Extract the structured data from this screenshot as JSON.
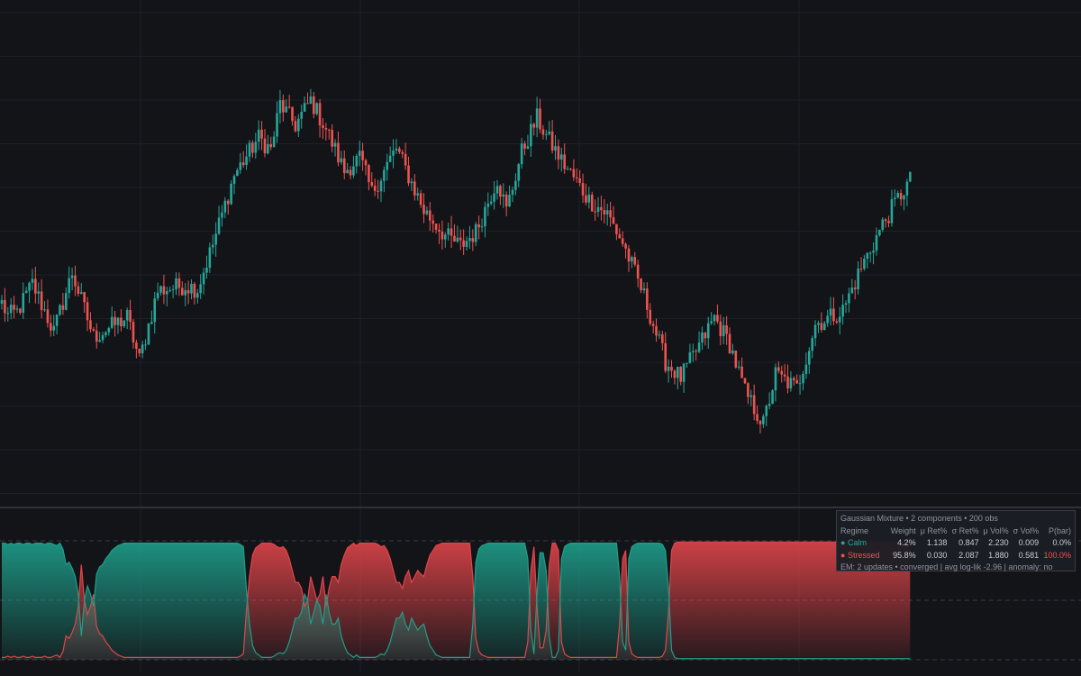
{
  "chart_data": [
    {
      "type": "candlestick",
      "colors": {
        "up": "#26a69a",
        "down": "#ef5350"
      },
      "grid": true,
      "segments": [
        [
          0,
          0.6
        ],
        [
          2,
          0.25
        ],
        [
          5,
          0.35
        ],
        [
          10,
          1.15
        ],
        [
          17,
          -0.2
        ],
        [
          23,
          1.45
        ],
        [
          30,
          -0.35
        ],
        [
          41,
          0.2
        ],
        [
          45,
          -1.0
        ],
        [
          51,
          0.95
        ],
        [
          60,
          1.1
        ],
        [
          64,
          1.0
        ],
        [
          69,
          2.25
        ],
        [
          76,
          4.2
        ],
        [
          84,
          5.25
        ],
        [
          88,
          4.9
        ],
        [
          91,
          6.2
        ],
        [
          96,
          5.6
        ],
        [
          101,
          6.3
        ],
        [
          106,
          5.5
        ],
        [
          112,
          4.3
        ],
        [
          117,
          4.7
        ],
        [
          121,
          3.7
        ],
        [
          129,
          4.95
        ],
        [
          138,
          3.2
        ],
        [
          145,
          2.5
        ],
        [
          150,
          2.2
        ],
        [
          155,
          2.6
        ],
        [
          162,
          4.1
        ],
        [
          165,
          3.2
        ],
        [
          170,
          4.85
        ],
        [
          175,
          5.8
        ],
        [
          178,
          5.3
        ],
        [
          183,
          4.6
        ],
        [
          188,
          4.0
        ],
        [
          192,
          3.5
        ],
        [
          198,
          3.1
        ],
        [
          203,
          2.3
        ],
        [
          210,
          0.8
        ],
        [
          217,
          -1.05
        ],
        [
          222,
          -1.5
        ],
        [
          228,
          -0.6
        ],
        [
          233,
          0.2
        ],
        [
          238,
          -0.55
        ],
        [
          243,
          -1.9
        ],
        [
          249,
          -2.8
        ],
        [
          253,
          -1.4
        ],
        [
          260,
          -1.8
        ],
        [
          266,
          0.0
        ],
        [
          275,
          0.4
        ],
        [
          281,
          1.6
        ],
        [
          288,
          2.8
        ],
        [
          292,
          3.4
        ],
        [
          297,
          4.05
        ]
      ],
      "bar_count": 298
    },
    {
      "type": "area",
      "ylim": [
        0,
        1
      ],
      "series": [
        {
          "color": "#1e9e8a",
          "values": [
            0.98,
            0.98,
            0.97,
            0.98,
            0.97,
            0.98,
            0.98,
            0.97,
            0.98,
            0.98,
            0.97,
            0.98,
            0.98,
            0.98,
            0.97,
            0.98,
            0.98,
            0.97,
            0.96,
            0.98,
            0.93,
            0.8,
            0.82,
            0.77,
            0.7,
            0.55,
            0.2,
            0.5,
            0.62,
            0.55,
            0.45,
            0.72,
            0.78,
            0.8,
            0.85,
            0.88,
            0.92,
            0.94,
            0.96,
            0.97,
            0.98,
            0.98,
            0.98,
            0.98,
            0.98,
            0.98,
            0.98,
            0.98,
            0.98,
            0.98,
            0.98,
            0.98,
            0.98,
            0.98,
            0.98,
            0.98,
            0.98,
            0.98,
            0.98,
            0.98,
            0.98,
            0.98,
            0.98,
            0.98,
            0.98,
            0.98,
            0.98,
            0.98,
            0.98,
            0.98,
            0.98,
            0.98,
            0.98,
            0.98,
            0.98,
            0.98,
            0.98,
            0.98,
            0.97,
            0.95,
            0.58,
            0.3,
            0.12,
            0.06,
            0.04,
            0.02,
            0.02,
            0.02,
            0.02,
            0.03,
            0.05,
            0.06,
            0.05,
            0.08,
            0.15,
            0.25,
            0.35,
            0.35,
            0.4,
            0.55,
            0.5,
            0.3,
            0.4,
            0.5,
            0.45,
            0.3,
            0.55,
            0.4,
            0.3,
            0.3,
            0.35,
            0.2,
            0.12,
            0.06,
            0.04,
            0.02,
            0.04,
            0.02,
            0.02,
            0.02,
            0.02,
            0.02,
            0.02,
            0.03,
            0.05,
            0.04,
            0.08,
            0.15,
            0.25,
            0.35,
            0.35,
            0.4,
            0.3,
            0.25,
            0.35,
            0.3,
            0.25,
            0.28,
            0.3,
            0.2,
            0.12,
            0.08,
            0.04,
            0.03,
            0.02,
            0.02,
            0.02,
            0.02,
            0.02,
            0.02,
            0.02,
            0.02,
            0.02,
            0.02,
            0.3,
            0.82,
            0.93,
            0.96,
            0.97,
            0.98,
            0.98,
            0.98,
            0.98,
            0.98,
            0.98,
            0.98,
            0.98,
            0.98,
            0.98,
            0.98,
            0.98,
            0.98,
            0.85,
            0.25,
            0.05,
            0.55,
            0.9,
            0.9,
            0.75,
            0.2,
            0.02,
            0.02,
            0.08,
            0.85,
            0.95,
            0.97,
            0.98,
            0.98,
            0.98,
            0.98,
            0.98,
            0.98,
            0.98,
            0.98,
            0.98,
            0.98,
            0.98,
            0.98,
            0.98,
            0.98,
            0.98,
            0.98,
            0.7,
            0.15,
            0.08,
            0.85,
            0.95,
            0.97,
            0.98,
            0.98,
            0.98,
            0.98,
            0.98,
            0.98,
            0.98,
            0.98,
            0.97,
            0.92,
            0.6,
            0.08,
            0.02,
            0.01,
            0.01,
            0.01,
            0.01,
            0.01,
            0.01,
            0.01,
            0.01,
            0.01,
            0.01,
            0.01,
            0.01,
            0.01,
            0.01,
            0.01,
            0.01,
            0.01,
            0.01,
            0.01,
            0.01,
            0.01,
            0.01,
            0.01,
            0.01,
            0.01,
            0.01,
            0.01,
            0.01,
            0.01,
            0.01,
            0.01,
            0.01,
            0.01,
            0.01,
            0.01,
            0.01,
            0.01,
            0.01,
            0.01,
            0.01,
            0.01,
            0.01,
            0.01,
            0.01,
            0.01,
            0.01,
            0.01,
            0.01,
            0.01,
            0.01,
            0.01,
            0.01,
            0.01,
            0.01,
            0.01,
            0.01,
            0.01,
            0.01,
            0.01,
            0.01,
            0.01,
            0.01,
            0.01,
            0.01,
            0.01,
            0.01,
            0.01,
            0.01,
            0.01,
            0.01,
            0.01,
            0.01,
            0.01,
            0.01,
            0.01,
            0.01,
            0.01
          ]
        },
        {
          "color": "#e0454a",
          "complement_of": 0
        }
      ]
    }
  ],
  "gmm_panel": {
    "title": "Gaussian Mixture • 2 components • 200 obs",
    "headers": [
      "Regime",
      "Weight",
      "μ Ret%",
      "σ Ret%",
      "μ Vol%",
      "σ Vol%",
      "P(bar)"
    ],
    "rows": [
      {
        "dot": "●",
        "name": "Calm",
        "color": "#26a69a",
        "weight": "4.2%",
        "mu_ret": "1.138",
        "sigma_ret": "0.847",
        "mu_vol": "2.230",
        "sigma_vol": "0.009",
        "p_bar": "0.0%"
      },
      {
        "dot": "●",
        "name": "Stressed",
        "color": "#ef5350",
        "weight": "95.8%",
        "mu_ret": "0.030",
        "sigma_ret": "2.087",
        "mu_vol": "1.880",
        "sigma_vol": "0.581",
        "p_bar": "100.0%"
      }
    ],
    "footer": "EM: 2 updates • converged | avg log-lik -2.96 | anomaly: no"
  }
}
